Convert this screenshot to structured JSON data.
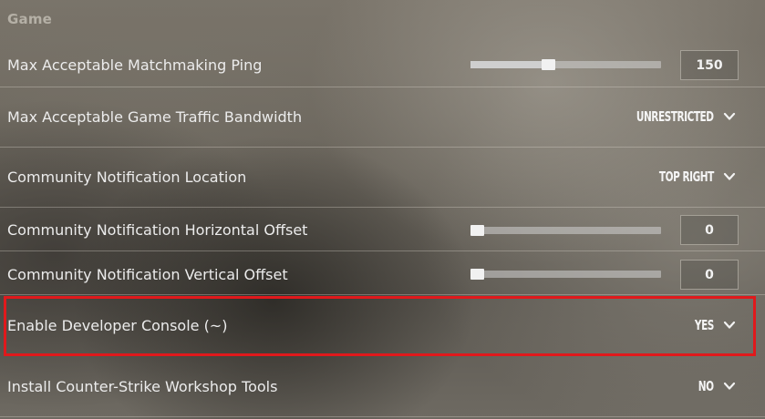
{
  "section": {
    "title": "Game"
  },
  "settings": [
    {
      "label": "Max Acceptable Matchmaking Ping",
      "control": "slider",
      "value": "150",
      "slider_fraction": 0.4
    },
    {
      "label": "Max Acceptable Game Traffic Bandwidth",
      "control": "dropdown",
      "value": "UNRESTRICTED"
    },
    {
      "label": "Community Notification Location",
      "control": "dropdown",
      "value": "TOP RIGHT"
    },
    {
      "label": "Community Notification Horizontal Offset",
      "control": "slider",
      "value": "0",
      "slider_fraction": 0.0
    },
    {
      "label": "Community Notification Vertical Offset",
      "control": "slider",
      "value": "0",
      "slider_fraction": 0.0
    },
    {
      "label": "Enable Developer Console (~)",
      "control": "dropdown",
      "value": "YES",
      "highlighted": true
    },
    {
      "label": "Install Counter-Strike Workshop Tools",
      "control": "dropdown",
      "value": "NO"
    }
  ],
  "colors": {
    "highlight_border": "#e0191c",
    "text": "#ececec",
    "section_title": "#b5b0a6"
  },
  "icons": {
    "dropdown": "chevron-down-icon"
  }
}
